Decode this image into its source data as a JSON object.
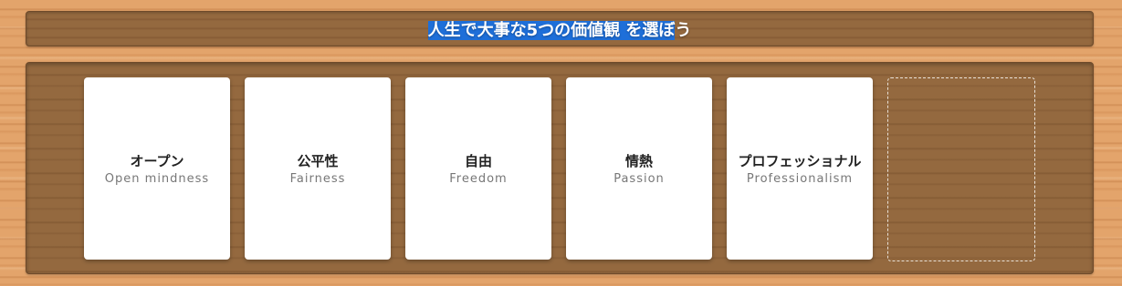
{
  "header": {
    "title_selected": "人生で大事な5つの価値観 を選ぼ",
    "title_rest": "う"
  },
  "cards": [
    {
      "jp": "オープン",
      "en": "Open mindness"
    },
    {
      "jp": "公平性",
      "en": "Fairness"
    },
    {
      "jp": "自由",
      "en": "Freedom"
    },
    {
      "jp": "情熱",
      "en": "Passion"
    },
    {
      "jp": "プロフェッショナル",
      "en": "Professionalism"
    }
  ],
  "colors": {
    "selection": "#1e6fd9",
    "card": "#ffffff",
    "board": "#94693f"
  }
}
